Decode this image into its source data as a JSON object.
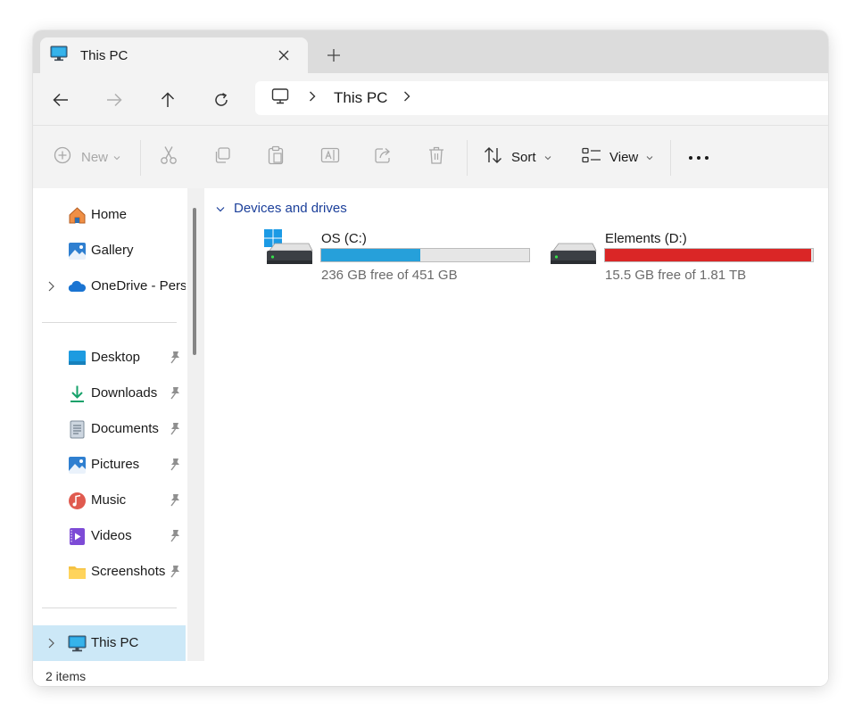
{
  "window": {
    "tab_title": "This PC",
    "status_count": "2 items"
  },
  "address": {
    "crumb": "This PC"
  },
  "toolbar": {
    "new_label": "New",
    "sort_label": "Sort",
    "view_label": "View"
  },
  "sidebar": {
    "quick": [
      {
        "label": "Home",
        "icon": "home-icon"
      },
      {
        "label": "Gallery",
        "icon": "gallery-icon"
      },
      {
        "label": "OneDrive - Perso",
        "icon": "onedrive-icon"
      }
    ],
    "pinned": [
      {
        "label": "Desktop",
        "icon": "desktop-icon"
      },
      {
        "label": "Downloads",
        "icon": "downloads-icon"
      },
      {
        "label": "Documents",
        "icon": "documents-icon"
      },
      {
        "label": "Pictures",
        "icon": "pictures-icon"
      },
      {
        "label": "Music",
        "icon": "music-icon"
      },
      {
        "label": "Videos",
        "icon": "videos-icon"
      },
      {
        "label": "Screenshots",
        "icon": "folder-icon"
      }
    ],
    "this_pc": {
      "label": "This PC",
      "icon": "this-pc-icon"
    }
  },
  "main": {
    "group_title": "Devices and drives",
    "drives": [
      {
        "name": "OS (C:)",
        "free_text": "236 GB free of 451 GB",
        "used_fraction": 0.477,
        "bar_color": "#26a0da"
      },
      {
        "name": "Elements (D:)",
        "free_text": "15.5 GB free of 1.81 TB",
        "used_fraction": 0.992,
        "bar_color": "#da2626"
      }
    ]
  },
  "colors": {
    "accent": "#0067c0",
    "selection": "#cce8f7",
    "group_heading": "#1b3f9a"
  }
}
